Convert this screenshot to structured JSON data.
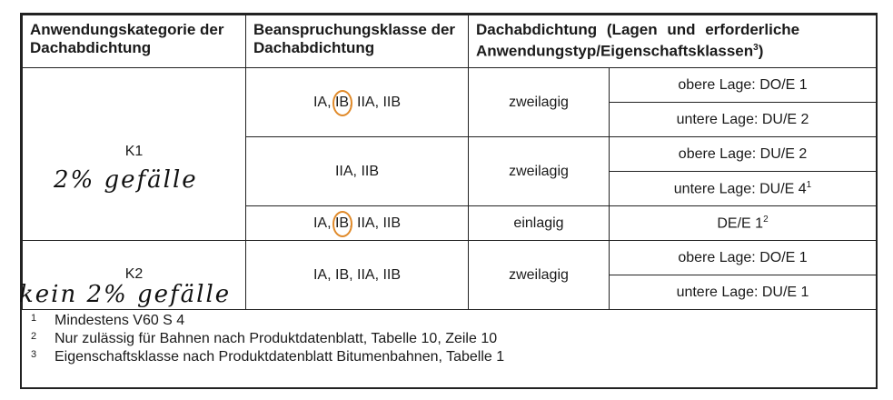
{
  "headers": {
    "col1": "Anwendungskategorie der Dachabdichtung",
    "col2": "Beanspruchungsklasse der Dachabdichtung",
    "col3": "Dachabdichtung (Lagen und erforderliche Anwendungstyp/Eigenschaftsklassen",
    "col3_sup": "3",
    "col3_end": ")"
  },
  "rows": {
    "k1": {
      "category": "K1",
      "handwritten_note": "2% gefälle",
      "g1": {
        "class_a": "IA, ",
        "class_circled": "IB",
        "class_b": ", IIA, IIB",
        "layers": "zweilagig",
        "upper": "obere Lage: DO/E 1",
        "lower": "untere Lage: DU/E 2"
      },
      "g2": {
        "class": "IIA, IIB",
        "layers": "zweilagig",
        "upper": "obere Lage: DU/E 2",
        "lower": "untere Lage: DU/E 4",
        "lower_sup": "1"
      },
      "g3": {
        "class_a": "IA, ",
        "class_circled": "IB",
        "class_b": ", IIA, IIB",
        "layers": "einlagig",
        "spec": "DE/E 1",
        "spec_sup": "2"
      }
    },
    "k2": {
      "category": "K2",
      "handwritten_note": "kein 2% gefälle",
      "class": "IA, IB, IIA, IIB",
      "layers": "zweilagig",
      "upper": "obere Lage: DO/E 1",
      "lower": "untere Lage: DU/E 1"
    }
  },
  "footnotes": [
    {
      "mark": "1",
      "text": "Mindestens V60 S 4"
    },
    {
      "mark": "2",
      "text": "Nur zulässig für Bahnen nach Produktdatenblatt, Tabelle 10, Zeile 10"
    },
    {
      "mark": "3",
      "text": "Eigenschaftsklasse nach Produktdatenblatt Bitumenbahnen, Tabelle 1"
    }
  ],
  "colors": {
    "annotation": "#e08a2a",
    "border": "#222222"
  }
}
